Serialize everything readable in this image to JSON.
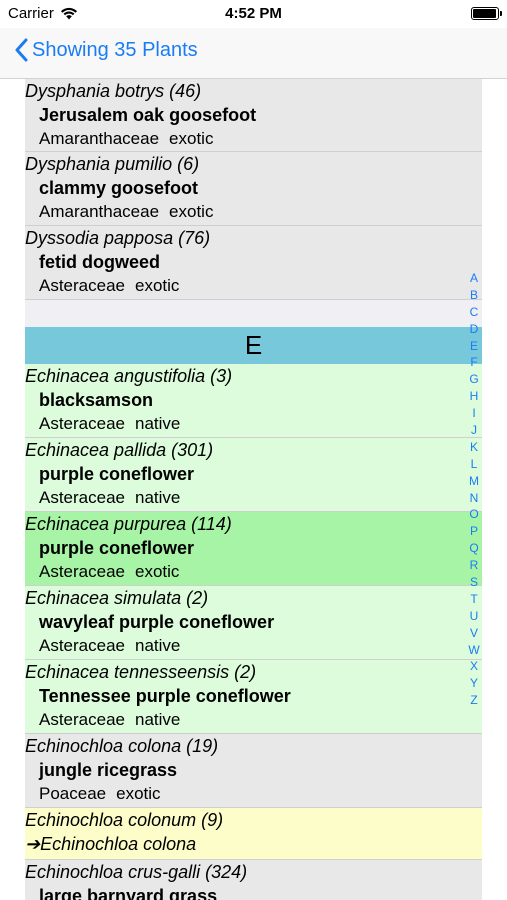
{
  "status_bar": {
    "carrier": "Carrier",
    "time": "4:52 PM",
    "battery_level": 0.95
  },
  "nav": {
    "back_label": "Showing 35 Plants"
  },
  "plants_top": [
    {
      "sci": "Dysphania botrys  (46)",
      "common": "Jerusalem oak goosefoot",
      "family": "Amaranthaceae",
      "status": "exotic",
      "color": "gray"
    },
    {
      "sci": "Dysphania pumilio  (6)",
      "common": "clammy goosefoot",
      "family": "Amaranthaceae",
      "status": "exotic",
      "color": "gray"
    },
    {
      "sci": "Dyssodia papposa  (76)",
      "common": "fetid dogweed",
      "family": "Asteraceae",
      "status": "exotic",
      "color": "gray"
    }
  ],
  "section": {
    "letter": "E"
  },
  "plants_e": [
    {
      "sci": "Echinacea angustifolia  (3)",
      "common": "blacksamson",
      "family": "Asteraceae",
      "status": "native",
      "color": "lightgreen"
    },
    {
      "sci": "Echinacea pallida  (301)",
      "common": "purple coneflower",
      "family": "Asteraceae",
      "status": "native",
      "color": "lightgreen"
    },
    {
      "sci": "Echinacea purpurea  (114)",
      "common": "purple coneflower",
      "family": "Asteraceae",
      "status": "exotic",
      "color": "green"
    },
    {
      "sci": "Echinacea simulata  (2)",
      "common": "wavyleaf purple coneflower",
      "family": "Asteraceae",
      "status": "native",
      "color": "lightgreen"
    },
    {
      "sci": "Echinacea tennesseensis  (2)",
      "common": "Tennessee purple coneflower",
      "family": "Asteraceae",
      "status": "native",
      "color": "lightgreen"
    },
    {
      "sci": "Echinochloa colona  (19)",
      "common": "jungle ricegrass",
      "family": "Poaceae",
      "status": "exotic",
      "color": "gray"
    }
  ],
  "synonym": {
    "sci": "Echinochloa colonum  (9)",
    "redirect": "➔Echinochloa colona"
  },
  "plant_last": {
    "sci": "Echinochloa crus-galli  (324)",
    "common": "large barnyard grass"
  },
  "index_letters": [
    "A",
    "B",
    "C",
    "D",
    "E",
    "F",
    "G",
    "H",
    "I",
    "J",
    "K",
    "L",
    "M",
    "N",
    "O",
    "P",
    "Q",
    "R",
    "S",
    "T",
    "U",
    "V",
    "W",
    "X",
    "Y",
    "Z"
  ],
  "colors": {
    "accent": "#1a7cf5",
    "section_header": "#77c8da",
    "native_row": "#dcfcdb",
    "selected_row": "#a8f4a6",
    "synonym_row": "#fdfdc9",
    "exotic_row": "#e8e8e8"
  }
}
